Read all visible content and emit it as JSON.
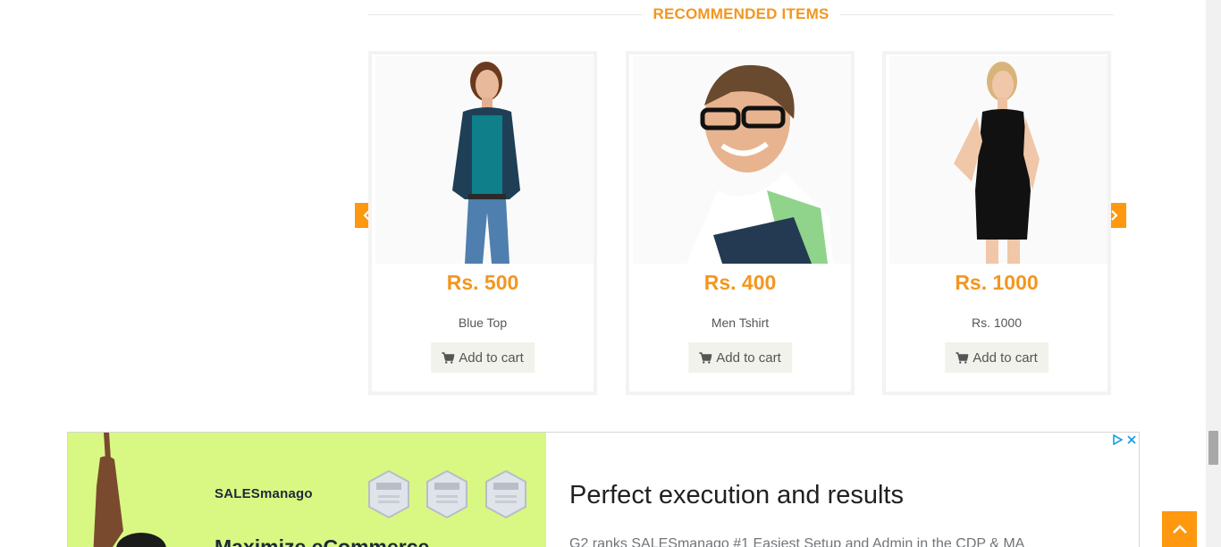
{
  "section": {
    "title": "RECOMMENDED ITEMS"
  },
  "products": [
    {
      "price": "Rs. 500",
      "name": "Blue Top",
      "cart_label": "Add to cart"
    },
    {
      "price": "Rs. 400",
      "name": "Men Tshirt",
      "cart_label": "Add to cart"
    },
    {
      "price": "Rs. 1000",
      "name": "Rs. 1000",
      "cart_label": "Add to cart"
    }
  ],
  "carousel": {
    "prev_icon": "chevron-left-icon",
    "next_icon": "chevron-right-icon"
  },
  "ad": {
    "brand": "SALESmanago",
    "left_headline": "Maximize eCommerce",
    "title": "Perfect execution and results",
    "description": "G2 ranks SALESmanago #1 Easiest Setup and Admin in the CDP & MA"
  },
  "colors": {
    "accent": "#fe980f",
    "price": "#f3961f",
    "ad_green": "#d9f883"
  }
}
